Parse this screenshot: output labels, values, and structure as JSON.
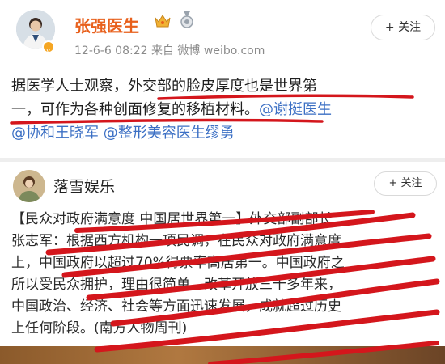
{
  "post1": {
    "author": "张强医生",
    "meta": "12-6-6 08:22  来自 微博 weibo.com",
    "follow_label": "+ 关注",
    "line1": "据医学人士观察，外交部的脸皮厚度也是世界第",
    "line2_text": "一，可作为各种创面修复的移植材料。",
    "line2_mention": "@谢挺医生",
    "line3_mention_a": "@协和王晓军",
    "line3_mention_b": "@整形美容医生缪勇"
  },
  "post2": {
    "author": "落雪娱乐",
    "follow_label": "+ 关注",
    "lines": [
      "【民众对政府满意度 中国居世界第一】外交部副部长",
      "张志军：根据西方机构一项民调，在民众对政府满意度",
      "上，中国政府以超过70%得票率高居第一。中国政府之",
      "所以受民众拥护，理由很简单，改革开放三十多年来，",
      "中国政治、经济、社会等方面迅速发展，成就超过历史",
      "上任何阶段。(南方人物周刊)"
    ]
  },
  "icons": {
    "verified": "verified-badge-icon",
    "crown": "crown-icon",
    "medal": "medal-icon"
  },
  "colors": {
    "author_orange": "#e8601c",
    "mention_blue": "#3b6fc4",
    "marker_red": "#d4161c"
  }
}
